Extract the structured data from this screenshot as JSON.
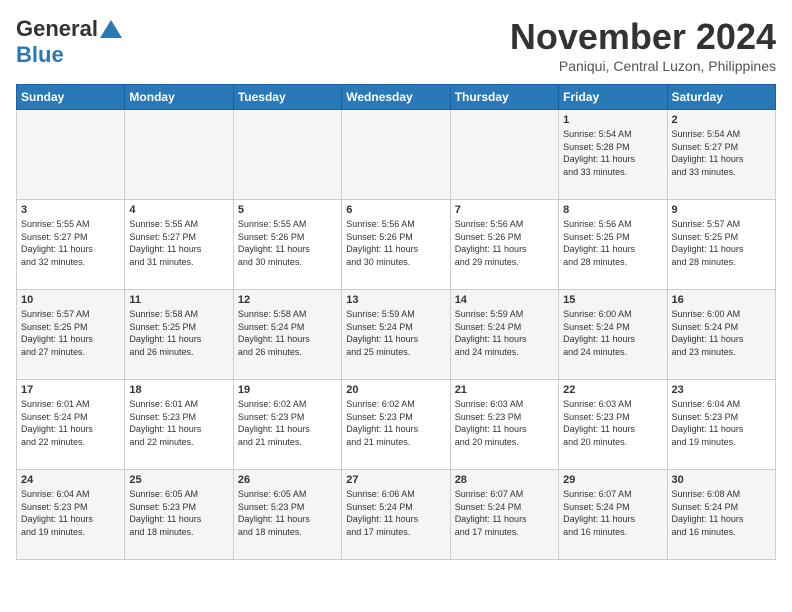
{
  "logo": {
    "general": "General",
    "blue": "Blue",
    "triangle": "▲"
  },
  "title": "November 2024",
  "location": "Paniqui, Central Luzon, Philippines",
  "headers": [
    "Sunday",
    "Monday",
    "Tuesday",
    "Wednesday",
    "Thursday",
    "Friday",
    "Saturday"
  ],
  "weeks": [
    [
      {
        "day": "",
        "info": ""
      },
      {
        "day": "",
        "info": ""
      },
      {
        "day": "",
        "info": ""
      },
      {
        "day": "",
        "info": ""
      },
      {
        "day": "",
        "info": ""
      },
      {
        "day": "1",
        "info": "Sunrise: 5:54 AM\nSunset: 5:28 PM\nDaylight: 11 hours\nand 33 minutes."
      },
      {
        "day": "2",
        "info": "Sunrise: 5:54 AM\nSunset: 5:27 PM\nDaylight: 11 hours\nand 33 minutes."
      }
    ],
    [
      {
        "day": "3",
        "info": "Sunrise: 5:55 AM\nSunset: 5:27 PM\nDaylight: 11 hours\nand 32 minutes."
      },
      {
        "day": "4",
        "info": "Sunrise: 5:55 AM\nSunset: 5:27 PM\nDaylight: 11 hours\nand 31 minutes."
      },
      {
        "day": "5",
        "info": "Sunrise: 5:55 AM\nSunset: 5:26 PM\nDaylight: 11 hours\nand 30 minutes."
      },
      {
        "day": "6",
        "info": "Sunrise: 5:56 AM\nSunset: 5:26 PM\nDaylight: 11 hours\nand 30 minutes."
      },
      {
        "day": "7",
        "info": "Sunrise: 5:56 AM\nSunset: 5:26 PM\nDaylight: 11 hours\nand 29 minutes."
      },
      {
        "day": "8",
        "info": "Sunrise: 5:56 AM\nSunset: 5:25 PM\nDaylight: 11 hours\nand 28 minutes."
      },
      {
        "day": "9",
        "info": "Sunrise: 5:57 AM\nSunset: 5:25 PM\nDaylight: 11 hours\nand 28 minutes."
      }
    ],
    [
      {
        "day": "10",
        "info": "Sunrise: 5:57 AM\nSunset: 5:25 PM\nDaylight: 11 hours\nand 27 minutes."
      },
      {
        "day": "11",
        "info": "Sunrise: 5:58 AM\nSunset: 5:25 PM\nDaylight: 11 hours\nand 26 minutes."
      },
      {
        "day": "12",
        "info": "Sunrise: 5:58 AM\nSunset: 5:24 PM\nDaylight: 11 hours\nand 26 minutes."
      },
      {
        "day": "13",
        "info": "Sunrise: 5:59 AM\nSunset: 5:24 PM\nDaylight: 11 hours\nand 25 minutes."
      },
      {
        "day": "14",
        "info": "Sunrise: 5:59 AM\nSunset: 5:24 PM\nDaylight: 11 hours\nand 24 minutes."
      },
      {
        "day": "15",
        "info": "Sunrise: 6:00 AM\nSunset: 5:24 PM\nDaylight: 11 hours\nand 24 minutes."
      },
      {
        "day": "16",
        "info": "Sunrise: 6:00 AM\nSunset: 5:24 PM\nDaylight: 11 hours\nand 23 minutes."
      }
    ],
    [
      {
        "day": "17",
        "info": "Sunrise: 6:01 AM\nSunset: 5:24 PM\nDaylight: 11 hours\nand 22 minutes."
      },
      {
        "day": "18",
        "info": "Sunrise: 6:01 AM\nSunset: 5:23 PM\nDaylight: 11 hours\nand 22 minutes."
      },
      {
        "day": "19",
        "info": "Sunrise: 6:02 AM\nSunset: 5:23 PM\nDaylight: 11 hours\nand 21 minutes."
      },
      {
        "day": "20",
        "info": "Sunrise: 6:02 AM\nSunset: 5:23 PM\nDaylight: 11 hours\nand 21 minutes."
      },
      {
        "day": "21",
        "info": "Sunrise: 6:03 AM\nSunset: 5:23 PM\nDaylight: 11 hours\nand 20 minutes."
      },
      {
        "day": "22",
        "info": "Sunrise: 6:03 AM\nSunset: 5:23 PM\nDaylight: 11 hours\nand 20 minutes."
      },
      {
        "day": "23",
        "info": "Sunrise: 6:04 AM\nSunset: 5:23 PM\nDaylight: 11 hours\nand 19 minutes."
      }
    ],
    [
      {
        "day": "24",
        "info": "Sunrise: 6:04 AM\nSunset: 5:23 PM\nDaylight: 11 hours\nand 19 minutes."
      },
      {
        "day": "25",
        "info": "Sunrise: 6:05 AM\nSunset: 5:23 PM\nDaylight: 11 hours\nand 18 minutes."
      },
      {
        "day": "26",
        "info": "Sunrise: 6:05 AM\nSunset: 5:23 PM\nDaylight: 11 hours\nand 18 minutes."
      },
      {
        "day": "27",
        "info": "Sunrise: 6:06 AM\nSunset: 5:24 PM\nDaylight: 11 hours\nand 17 minutes."
      },
      {
        "day": "28",
        "info": "Sunrise: 6:07 AM\nSunset: 5:24 PM\nDaylight: 11 hours\nand 17 minutes."
      },
      {
        "day": "29",
        "info": "Sunrise: 6:07 AM\nSunset: 5:24 PM\nDaylight: 11 hours\nand 16 minutes."
      },
      {
        "day": "30",
        "info": "Sunrise: 6:08 AM\nSunset: 5:24 PM\nDaylight: 11 hours\nand 16 minutes."
      }
    ]
  ]
}
